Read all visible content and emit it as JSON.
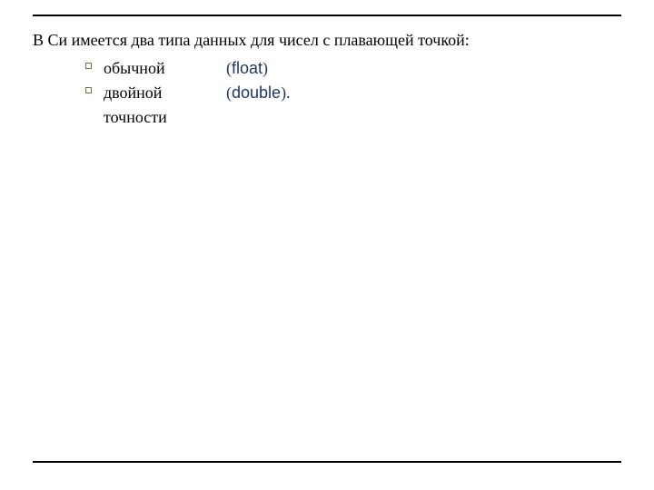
{
  "lead": "В Си имеется два типа данных для чисел с плавающей точкой:",
  "items": [
    {
      "label": "обычной",
      "open": "(",
      "keyword": "float",
      "close": ")"
    },
    {
      "label": "двойной точности ",
      "open": "(",
      "keyword": "double",
      "close": ")."
    }
  ]
}
